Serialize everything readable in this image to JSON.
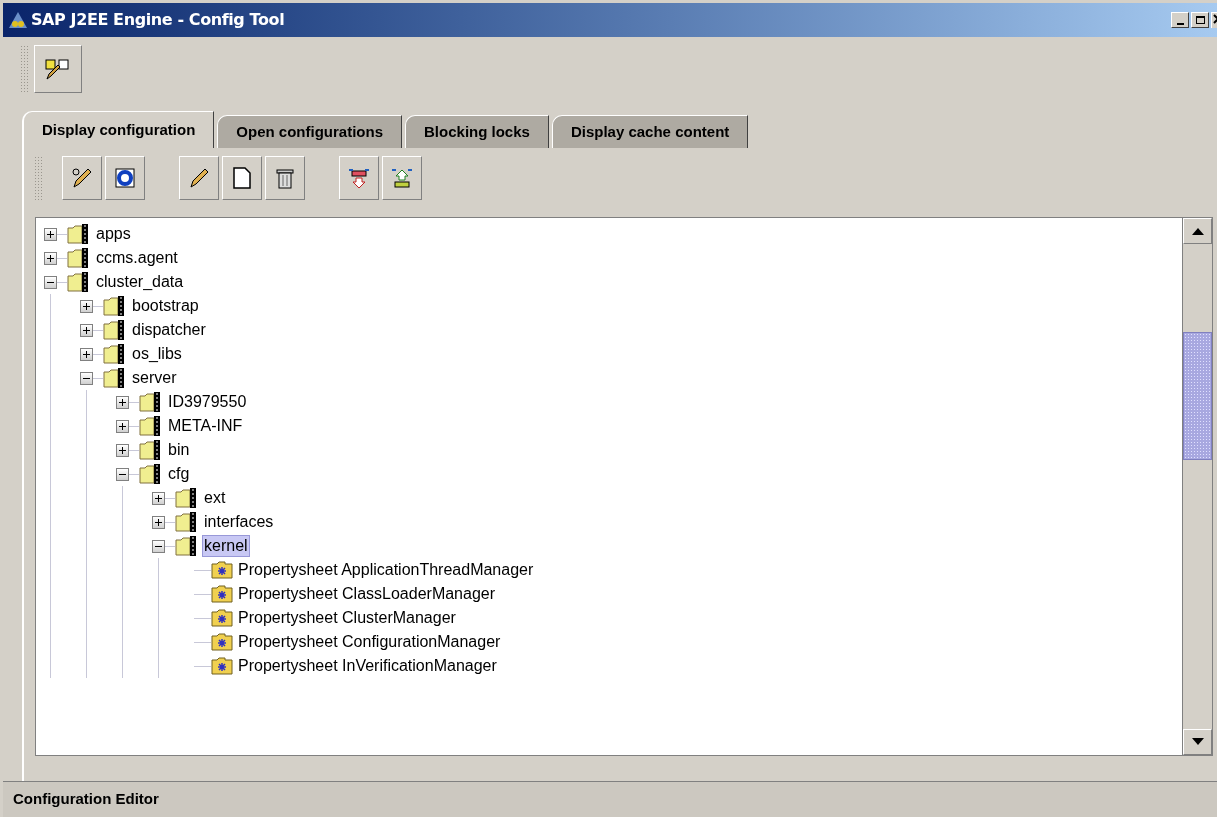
{
  "window": {
    "title": "SAP J2EE Engine - Config Tool"
  },
  "tabs": [
    {
      "label": "Display configuration",
      "selected": true
    },
    {
      "label": "Open configurations",
      "selected": false
    },
    {
      "label": "Blocking locks",
      "selected": false
    },
    {
      "label": "Display cache content",
      "selected": false
    }
  ],
  "tree": [
    {
      "label": "apps",
      "kind": "folder",
      "expanded": false,
      "selected": false
    },
    {
      "label": "ccms.agent",
      "kind": "folder",
      "expanded": false,
      "selected": false
    },
    {
      "label": "cluster_data",
      "kind": "folder",
      "expanded": true,
      "selected": false,
      "children": [
        {
          "label": "bootstrap",
          "kind": "folder",
          "expanded": false,
          "selected": false
        },
        {
          "label": "dispatcher",
          "kind": "folder",
          "expanded": false,
          "selected": false
        },
        {
          "label": "os_libs",
          "kind": "folder",
          "expanded": false,
          "selected": false
        },
        {
          "label": "server",
          "kind": "folder",
          "expanded": true,
          "selected": false,
          "children": [
            {
              "label": "ID3979550",
              "kind": "folder",
              "expanded": false,
              "selected": false
            },
            {
              "label": "META-INF",
              "kind": "folder",
              "expanded": false,
              "selected": false
            },
            {
              "label": "bin",
              "kind": "folder",
              "expanded": false,
              "selected": false
            },
            {
              "label": "cfg",
              "kind": "folder",
              "expanded": true,
              "selected": false,
              "children": [
                {
                  "label": "ext",
                  "kind": "folder",
                  "expanded": false,
                  "selected": false
                },
                {
                  "label": "interfaces",
                  "kind": "folder",
                  "expanded": false,
                  "selected": false
                },
                {
                  "label": "kernel",
                  "kind": "folder",
                  "expanded": true,
                  "selected": true,
                  "children": [
                    {
                      "label": "Propertysheet ApplicationThreadManager",
                      "kind": "propertysheet",
                      "selected": false
                    },
                    {
                      "label": "Propertysheet ClassLoaderManager",
                      "kind": "propertysheet",
                      "selected": false
                    },
                    {
                      "label": "Propertysheet ClusterManager",
                      "kind": "propertysheet",
                      "selected": false
                    },
                    {
                      "label": "Propertysheet ConfigurationManager",
                      "kind": "propertysheet",
                      "selected": false
                    },
                    {
                      "label": "Propertysheet InVerificationManager",
                      "kind": "propertysheet",
                      "selected": false
                    }
                  ]
                }
              ]
            }
          ]
        }
      ]
    }
  ],
  "status_bar": {
    "text": "Configuration Editor"
  }
}
